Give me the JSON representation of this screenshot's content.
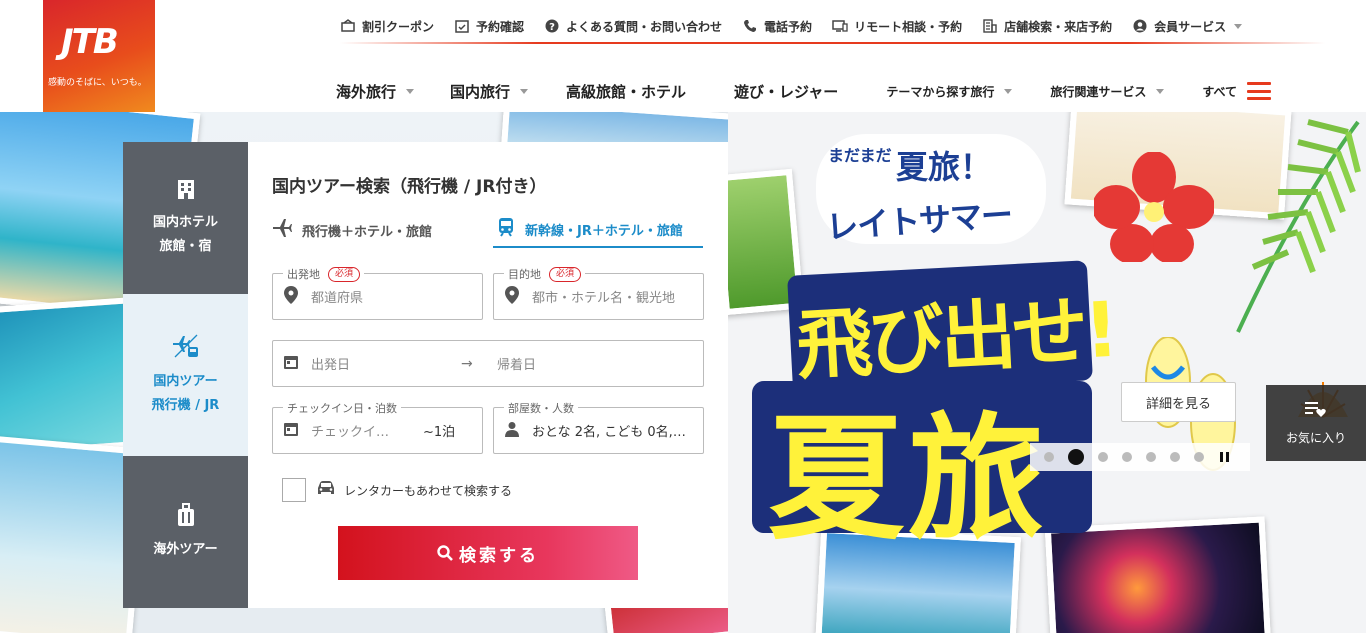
{
  "logo": {
    "mark": "JTB",
    "tagline": "感動のそばに、いつも。"
  },
  "utility_nav": [
    {
      "label": "割引クーポン",
      "icon": "coupon-icon"
    },
    {
      "label": "予約確認",
      "icon": "calendar-check-icon"
    },
    {
      "label": "よくある質問・お問い合わせ",
      "icon": "question-icon"
    },
    {
      "label": "電話予約",
      "icon": "phone-icon"
    },
    {
      "label": "リモート相談・予約",
      "icon": "monitor-icon"
    },
    {
      "label": "店舗検索・来店予約",
      "icon": "building-icon"
    },
    {
      "label": "会員サービス",
      "icon": "user-icon"
    }
  ],
  "global_nav": [
    {
      "label": "海外旅行"
    },
    {
      "label": "国内旅行"
    },
    {
      "label": "高級旅館・ホテル"
    },
    {
      "label": "遊び・レジャー"
    },
    {
      "label": "テーマから探す旅行"
    },
    {
      "label": "旅行関連サービス"
    },
    {
      "label": "すべて"
    }
  ],
  "side_tabs": [
    {
      "line1": "国内ホテル",
      "line2": "旅館・宿",
      "icon": "hotel-icon"
    },
    {
      "line1": "国内ツアー",
      "line2": "飛行機 / JR",
      "icon": "plane-train-icon"
    },
    {
      "line1": "海外ツアー",
      "line2": "",
      "icon": "suitcase-icon"
    }
  ],
  "search": {
    "title": "国内ツアー検索（飛行機 / JR付き）",
    "mode_air": "飛行機＋ホテル・旅館",
    "mode_rail": "新幹線・JR＋ホテル・旅館",
    "required": "必須",
    "origin_label": "出発地",
    "origin_placeholder": "都道府県",
    "dest_label": "目的地",
    "dest_placeholder": "都市・ホテル名・観光地",
    "depart_placeholder": "出発日",
    "return_placeholder": "帰着日",
    "checkin_label": "チェックイン日・泊数",
    "checkin_placeholder": "チェックイ…",
    "nights": "~1泊",
    "rooms_label": "部屋数・人数",
    "rooms_value": "おとな 2名, こども 0名,…",
    "rental_label": "レンタカーもあわせて検索する",
    "search_button": "検索する"
  },
  "banner": {
    "tagline1": "まだまだ",
    "tagline2": "夏旅！",
    "tagline3": "レイトサマー",
    "headline1": "飛び出せ!",
    "headline2": "夏旅",
    "detail_button": "詳細を見る",
    "favorite": "お気に入り"
  }
}
